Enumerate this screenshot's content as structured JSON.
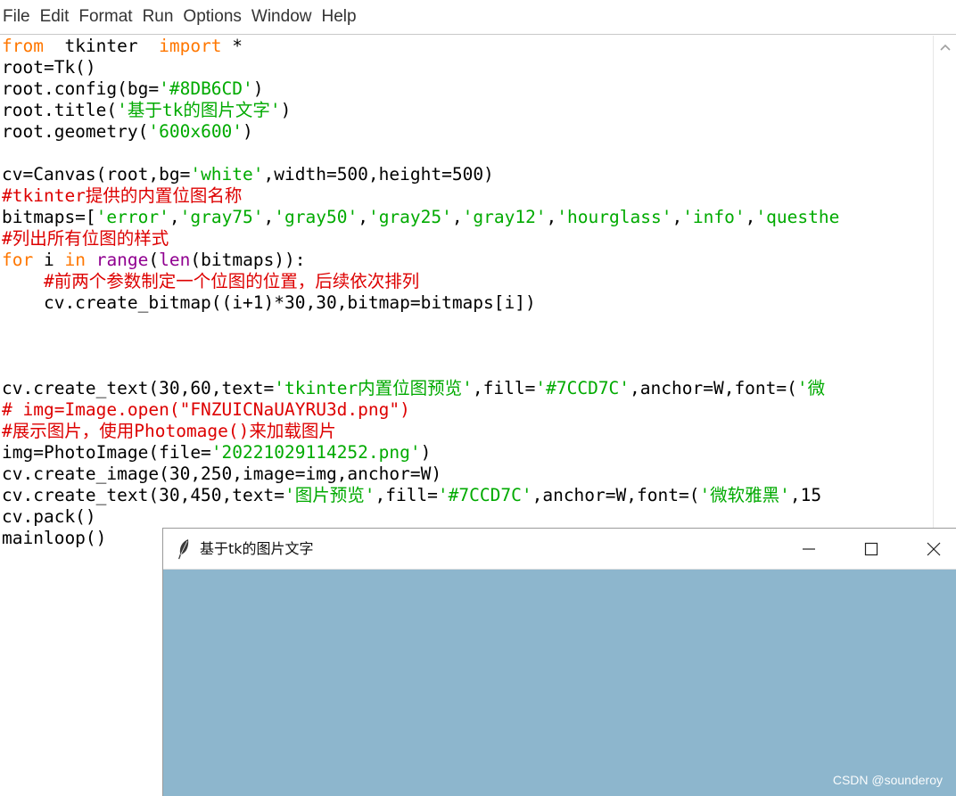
{
  "menubar": {
    "items": [
      "File",
      "Edit",
      "Format",
      "Run",
      "Options",
      "Window",
      "Help"
    ]
  },
  "editor": {
    "lines": [
      [
        [
          "kw",
          "from"
        ],
        [
          "",
          "  tkinter  "
        ],
        [
          "kw",
          "import"
        ],
        [
          "",
          " *"
        ]
      ],
      [
        [
          "",
          "root=Tk()"
        ]
      ],
      [
        [
          "",
          "root.config(bg="
        ],
        [
          "st",
          "'#8DB6CD'"
        ],
        [
          "",
          ")"
        ]
      ],
      [
        [
          "",
          "root.title("
        ],
        [
          "st",
          "'基于tk的图片文字'"
        ],
        [
          "",
          ")"
        ]
      ],
      [
        [
          "",
          "root.geometry("
        ],
        [
          "st",
          "'600x600'"
        ],
        [
          "",
          ")"
        ]
      ],
      [],
      [
        [
          "",
          "cv=Canvas(root,bg="
        ],
        [
          "st",
          "'white'"
        ],
        [
          "",
          ",width=500,height=500)"
        ]
      ],
      [
        [
          "cm",
          "#tkinter提供的内置位图名称"
        ]
      ],
      [
        [
          "",
          "bitmaps=["
        ],
        [
          "st",
          "'error'"
        ],
        [
          "",
          ","
        ],
        [
          "st",
          "'gray75'"
        ],
        [
          "",
          ","
        ],
        [
          "st",
          "'gray50'"
        ],
        [
          "",
          ","
        ],
        [
          "st",
          "'gray25'"
        ],
        [
          "",
          ","
        ],
        [
          "st",
          "'gray12'"
        ],
        [
          "",
          ","
        ],
        [
          "st",
          "'hourglass'"
        ],
        [
          "",
          ","
        ],
        [
          "st",
          "'info'"
        ],
        [
          "",
          ","
        ],
        [
          "st",
          "'questhe"
        ]
      ],
      [
        [
          "cm",
          "#列出所有位图的样式"
        ]
      ],
      [
        [
          "kw",
          "for"
        ],
        [
          "",
          " i "
        ],
        [
          "kw",
          "in"
        ],
        [
          "",
          " "
        ],
        [
          "bi",
          "range"
        ],
        [
          "",
          "("
        ],
        [
          "bi",
          "len"
        ],
        [
          "",
          "(bitmaps)):"
        ]
      ],
      [
        [
          "",
          "    "
        ],
        [
          "cm",
          "#前两个参数制定一个位图的位置，后续依次排列"
        ]
      ],
      [
        [
          "",
          "    cv.create_bitmap((i+1)*30,30,bitmap=bitmaps[i])"
        ]
      ],
      [],
      [],
      [],
      [
        [
          "",
          "cv.create_text(30,60,text="
        ],
        [
          "st",
          "'tkinter内置位图预览'"
        ],
        [
          "",
          ",fill="
        ],
        [
          "st",
          "'#7CCD7C'"
        ],
        [
          "",
          ",anchor=W,font=("
        ],
        [
          "st",
          "'微"
        ]
      ],
      [
        [
          "cm",
          "# img=Image.open(\"FNZUICNaUAYRU3d.png\")"
        ]
      ],
      [
        [
          "cm",
          "#展示图片，使用Photomage()来加载图片"
        ]
      ],
      [
        [
          "",
          "img=PhotoImage(file="
        ],
        [
          "st",
          "'20221029114252.png'"
        ],
        [
          "",
          ")"
        ]
      ],
      [
        [
          "",
          "cv.create_image(30,250,image=img,anchor=W)"
        ]
      ],
      [
        [
          "",
          "cv.create_text(30,450,text="
        ],
        [
          "st",
          "'图片预览'"
        ],
        [
          "",
          ",fill="
        ],
        [
          "st",
          "'#7CCD7C'"
        ],
        [
          "",
          ",anchor=W,font=("
        ],
        [
          "st",
          "'微软雅黑'"
        ],
        [
          "",
          ",15"
        ]
      ],
      [
        [
          "",
          "cv.pack()"
        ]
      ],
      [
        [
          "",
          "mainloop()"
        ]
      ]
    ]
  },
  "tk_window": {
    "title": "基于tk的图片文字",
    "background": "#8DB6CD",
    "icon": "feather-icon"
  },
  "watermark": "CSDN @sounderoy",
  "colors": {
    "keyword": "#ff7700",
    "string": "#00aa00",
    "comment": "#dd0000",
    "builtin": "#900090"
  }
}
